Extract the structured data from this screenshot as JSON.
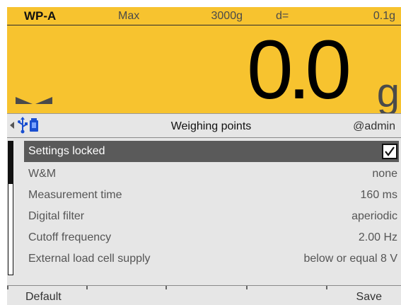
{
  "display": {
    "weighing_point": "WP-A",
    "max_label": "Max",
    "max_value": "3000g",
    "d_label": "d=",
    "d_value": "0.1g",
    "weight": "0.0",
    "unit": "g",
    "background_color": "#f7c32f"
  },
  "titlebar": {
    "title": "Weighing points",
    "user": "@admin",
    "icons": [
      "back-arrow-icon",
      "usb-icon",
      "device-icon"
    ]
  },
  "settings": [
    {
      "label": "Settings locked",
      "value": "",
      "checked": true,
      "selected": true
    },
    {
      "label": "W&M",
      "value": "none"
    },
    {
      "label": "Measurement time",
      "value": "160 ms"
    },
    {
      "label": "Digital filter",
      "value": "aperiodic"
    },
    {
      "label": "Cutoff frequency",
      "value": "2.00 Hz"
    },
    {
      "label": "External load cell supply",
      "value": "below or equal 8 V"
    }
  ],
  "footer": {
    "default_label": "Default",
    "save_label": "Save"
  }
}
